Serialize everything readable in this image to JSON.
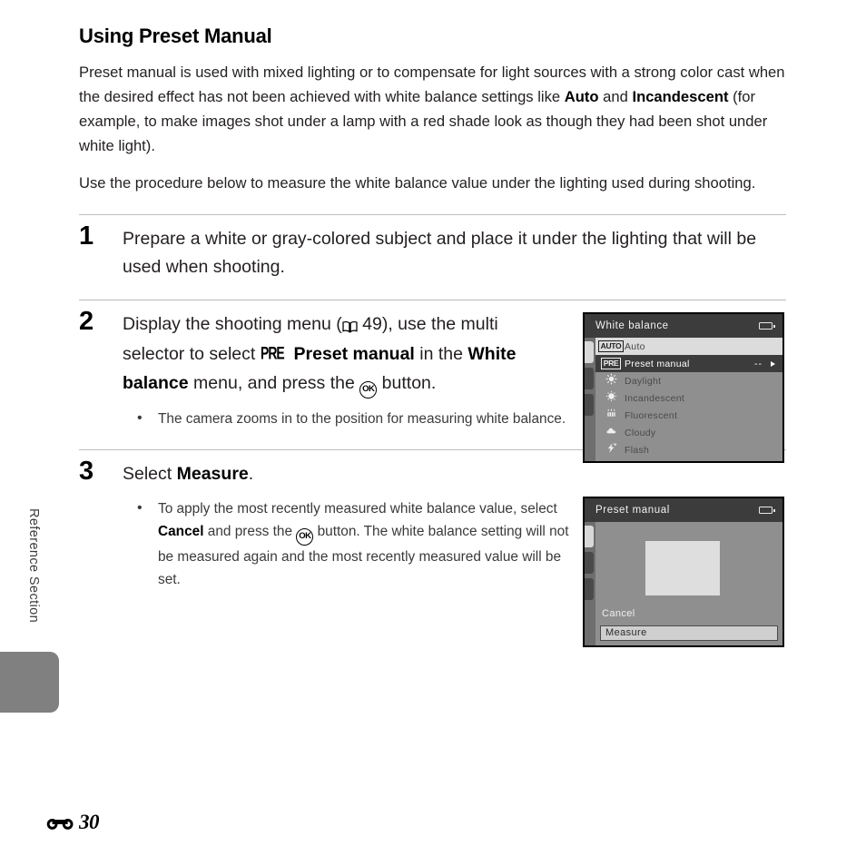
{
  "page": {
    "heading": "Using Preset Manual",
    "side_label": "Reference Section",
    "folio_number": "30",
    "folio_symbol": "E"
  },
  "intro": {
    "para1_a": "Preset manual is used with mixed lighting or to compensate for light sources with a strong color cast when the desired effect has not been achieved with white balance settings like ",
    "para1_bold1": "Auto",
    "para1_b": " and ",
    "para1_bold2": "Incandescent",
    "para1_c": " (for example, to make images shot under a lamp with a red shade look as though they had been shot under white light).",
    "para2": "Use the procedure below to measure the white balance value under the lighting used during shooting."
  },
  "steps": [
    {
      "number": "1",
      "text": "Prepare a white or gray-colored subject and place it under the lighting that will be used when shooting."
    },
    {
      "number": "2",
      "text_a": "Display the shooting menu (",
      "page_ref": "49",
      "text_b": "), use the multi selector to select ",
      "pre_glyph": "PRE",
      "bold1": "Preset manual",
      "text_c": " in the ",
      "bold2": "White balance",
      "text_d": " menu, and press the ",
      "ok_glyph": "OK",
      "text_e": " button.",
      "bullets": [
        "The camera zooms in to the position for measuring white balance."
      ]
    },
    {
      "number": "3",
      "text_a": "Select ",
      "bold1": "Measure",
      "text_b": ".",
      "bullet_a": "To apply the most recently measured white balance value, select ",
      "bullet_bold": "Cancel",
      "bullet_b": " and press the ",
      "bullet_ok": "OK",
      "bullet_c": " button. The white balance setting will not be measured again and the most recently measured value will be set."
    }
  ],
  "lcd_white_balance": {
    "title": "White balance",
    "battery_icon": "battery-icon",
    "rows": [
      {
        "badge": "AUTO",
        "icon": "auto-badge-icon",
        "label": "Auto",
        "value": "",
        "arrow": false,
        "state": "light"
      },
      {
        "badge": "PRE",
        "icon": "pre-badge-icon",
        "label": "Preset manual",
        "value": "--",
        "arrow": true,
        "state": "dark"
      },
      {
        "badge": "",
        "icon": "sun-icon",
        "label": "Daylight",
        "value": "",
        "arrow": false,
        "state": "none"
      },
      {
        "badge": "",
        "icon": "incandescent-icon",
        "label": "Incandescent",
        "value": "",
        "arrow": false,
        "state": "none"
      },
      {
        "badge": "",
        "icon": "fluorescent-icon",
        "label": "Fluorescent",
        "value": "",
        "arrow": false,
        "state": "none"
      },
      {
        "badge": "",
        "icon": "cloud-icon",
        "label": "Cloudy",
        "value": "",
        "arrow": false,
        "state": "none"
      },
      {
        "badge": "",
        "icon": "flash-icon",
        "label": "Flash",
        "value": "",
        "arrow": false,
        "state": "none"
      }
    ]
  },
  "lcd_preset_manual": {
    "title": "Preset manual",
    "battery_icon": "battery-icon",
    "cancel_label": "Cancel",
    "measure_label": "Measure"
  },
  "colors": {
    "lcd_header_bg": "#3c3c3c",
    "lcd_body_bg": "#8f8f8f",
    "highlight_dark": "#3c3c3c",
    "highlight_light": "#dcdcdc",
    "side_tab": "#808080",
    "rule": "#bdbdbd"
  }
}
